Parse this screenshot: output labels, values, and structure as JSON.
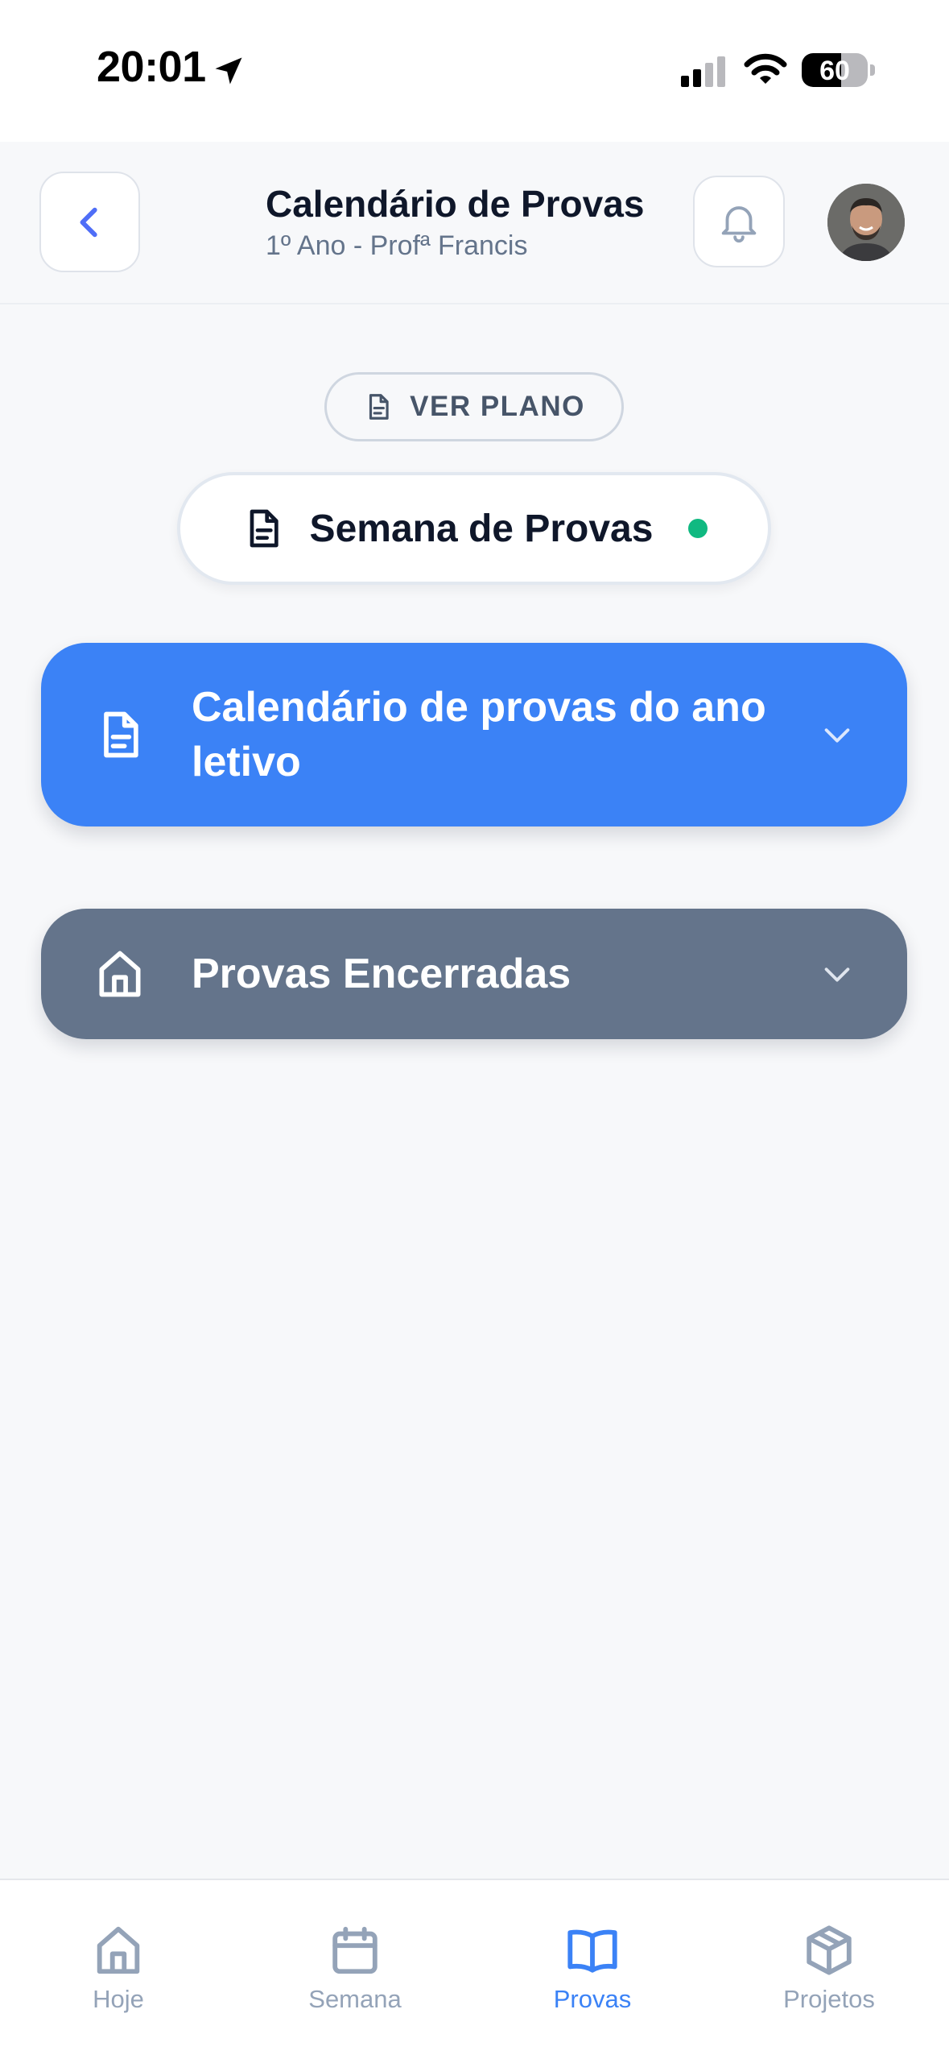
{
  "status_bar": {
    "time": "20:01",
    "battery": "60",
    "battery_fraction": 0.6
  },
  "header": {
    "title": "Calendário de Provas",
    "subtitle": "1º Ano - Profª Francis"
  },
  "ver_plano": {
    "label": "VER PLANO"
  },
  "week_pill": {
    "label": "Semana de Provas",
    "status_color": "#10b981"
  },
  "sections": [
    {
      "title": "Calendário de provas do ano letivo",
      "color": "#3b82f6",
      "icon": "document-icon"
    },
    {
      "title": "Provas Encerradas",
      "color": "#64748b",
      "icon": "home-icon"
    }
  ],
  "tabbar": {
    "active": "Provas",
    "accent": "#3b82f6",
    "tabs": [
      {
        "label": "Hoje",
        "icon": "home-icon"
      },
      {
        "label": "Semana",
        "icon": "calendar-icon"
      },
      {
        "label": "Provas",
        "icon": "book-icon"
      },
      {
        "label": "Projetos",
        "icon": "box-icon"
      }
    ]
  }
}
